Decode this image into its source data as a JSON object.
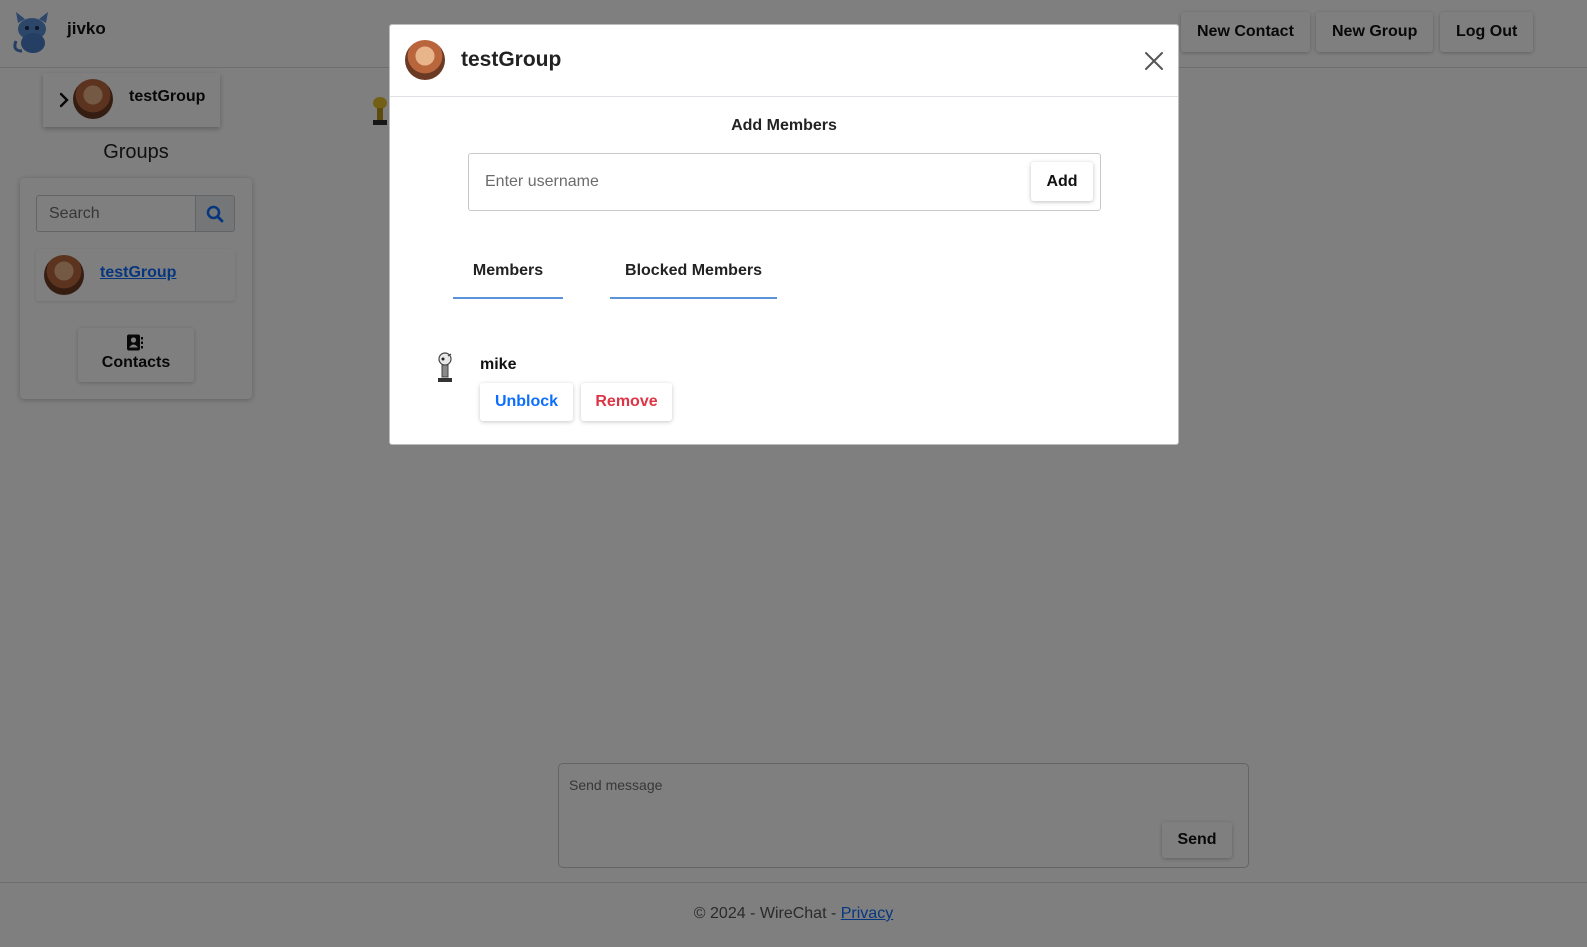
{
  "topbar": {
    "username": "jivko",
    "buttons": {
      "new_contact": "New Contact",
      "new_group": "New Group",
      "log_out": "Log Out"
    }
  },
  "current_chat": {
    "name": "testGroup"
  },
  "sidebar": {
    "heading": "Groups",
    "search_placeholder": "Search",
    "groups": [
      {
        "name": "testGroup"
      }
    ],
    "contacts_label": "Contacts"
  },
  "composer": {
    "placeholder": "Send message",
    "send_label": "Send"
  },
  "footer": {
    "text": "© 2024 - WireChat - ",
    "privacy_link": "Privacy"
  },
  "modal": {
    "title": "testGroup",
    "add_heading": "Add Members",
    "add_placeholder": "Enter username",
    "add_button": "Add",
    "tabs": [
      {
        "label": "Members"
      },
      {
        "label": "Blocked Members"
      }
    ],
    "blocked_members": [
      {
        "name": "mike",
        "unblock_label": "Unblock",
        "remove_label": "Remove"
      }
    ]
  },
  "colors": {
    "link": "#0d6efd",
    "unblock": "#0d6efd",
    "remove": "#dc3545",
    "tab_underline": "#5a93d8",
    "backdrop": "rgba(0,0,0,0.5)"
  }
}
